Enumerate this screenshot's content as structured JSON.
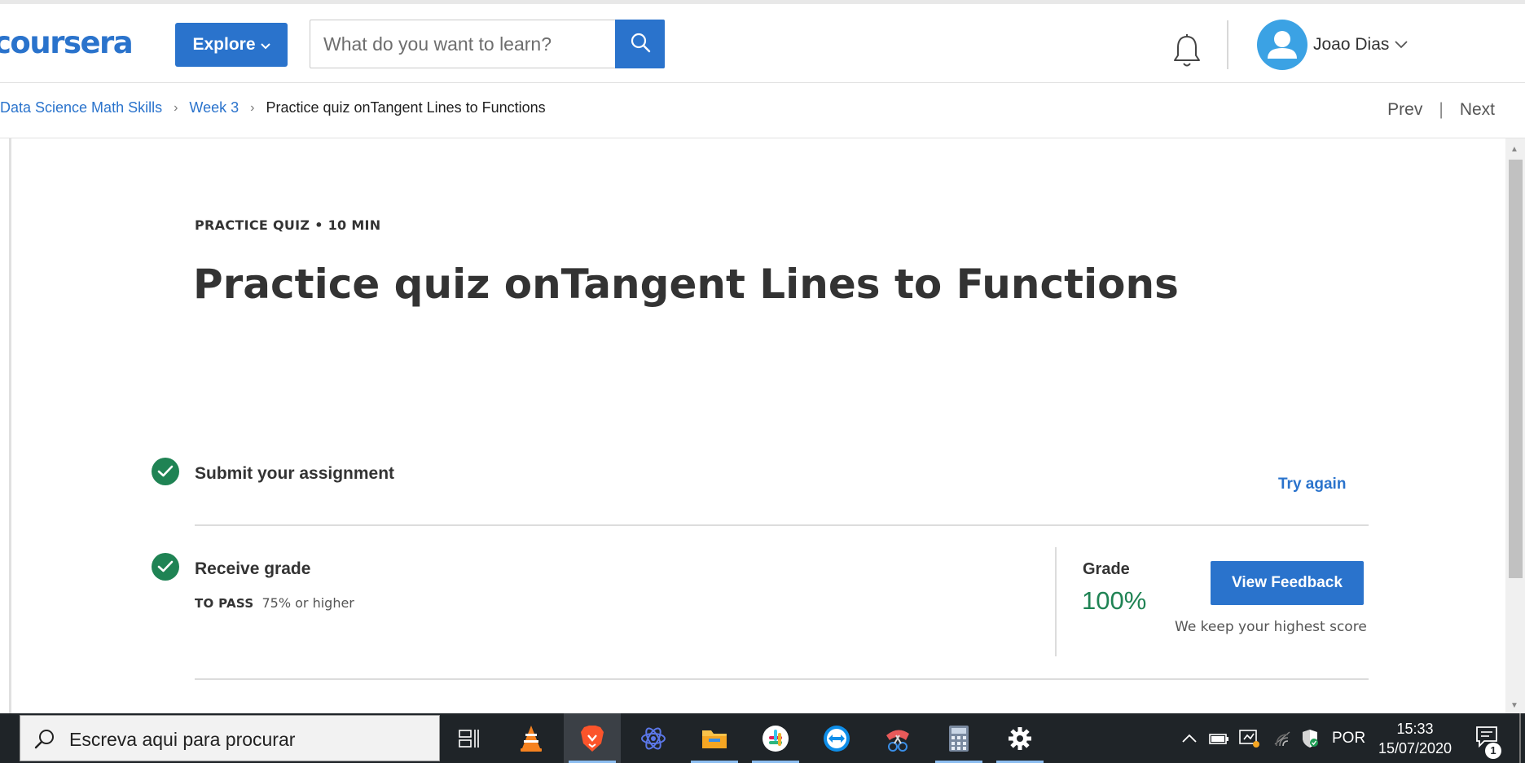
{
  "header": {
    "logo": "coursera",
    "explore_label": "Explore",
    "search_placeholder": "What do you want to learn?",
    "user_name": "Joao Dias"
  },
  "breadcrumb": {
    "items": [
      "Data Science Math Skills",
      "Week 3"
    ],
    "current": "Practice quiz onTangent Lines to Functions"
  },
  "nav": {
    "prev": "Prev",
    "separator": "|",
    "next": "Next"
  },
  "quiz": {
    "meta": "PRACTICE QUIZ • 10 MIN",
    "title": "Practice quiz onTangent Lines to Functions",
    "submit_step": "Submit your assignment",
    "try_again": "Try again",
    "receive_step": "Receive grade",
    "to_pass_label": "TO PASS",
    "to_pass_value": "75% or higher",
    "grade_label": "Grade",
    "grade_value": "100%",
    "feedback_button": "View Feedback",
    "highest_note": "We keep your highest score"
  },
  "taskbar": {
    "search_placeholder": "Escreva aqui para procurar",
    "language": "POR",
    "time": "15:33",
    "date": "15/07/2020",
    "notification_count": "1"
  },
  "colors": {
    "brand_blue": "#2a73cc",
    "success_green": "#1f8354",
    "taskbar": "#1f2428"
  }
}
